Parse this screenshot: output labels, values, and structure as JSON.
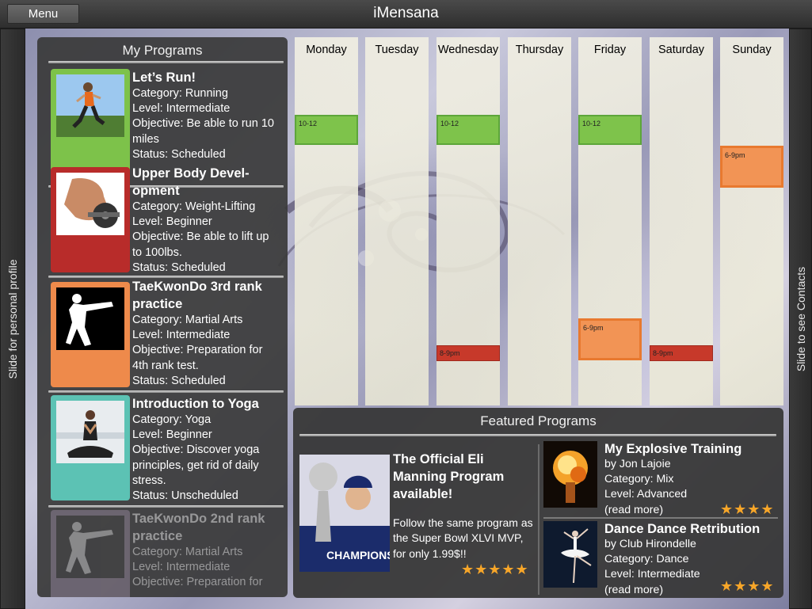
{
  "app": {
    "title": "iMensana",
    "menu_label": "Menu"
  },
  "side": {
    "left_label": "Slide for personal profile",
    "right_label": "Slide to see Contacts"
  },
  "programs": {
    "title": "My Programs",
    "items": [
      {
        "name": "Let’s Run!",
        "category": "Category: Running",
        "level": "Level: Intermediate",
        "objective": "Objective: Be able to run 10 miles",
        "status": "Status: Scheduled",
        "color": "#7dc24a"
      },
      {
        "name": "Upper Body Devel-opment",
        "category": "Category: Weight-Lifting",
        "level": "Level: Beginner",
        "objective": "Objective: Be able to lift up to 100lbs.",
        "status": "Status: Scheduled",
        "color": "#b82c2a"
      },
      {
        "name": "TaeKwonDo 3rd rank practice",
        "category": "Category: Martial Arts",
        "level": "Level: Intermediate",
        "objective": "Objective: Preparation for 4th rank test.",
        "status": "Status: Scheduled",
        "color": "#ee8a4b"
      },
      {
        "name": "Introduction to Yoga",
        "category": "Category: Yoga",
        "level": "Level: Beginner",
        "objective": "Objective: Discover yoga principles, get rid of daily stress.",
        "status": "Status: Unscheduled",
        "color": "#5cc2b4"
      },
      {
        "name": "TaeKwonDo 2nd rank practice",
        "category": "Category: Martial Arts",
        "level": "Level: Intermediate",
        "objective": "Objective: Preparation for",
        "status": "",
        "color": "#9e8fa6"
      }
    ]
  },
  "calendar": {
    "days": [
      "Monday",
      "Tuesday",
      "Wednesday",
      "Thursday",
      "Friday",
      "Saturday",
      "Sunday"
    ],
    "events": [
      {
        "day": "Monday",
        "time": "10-12",
        "color": "green"
      },
      {
        "day": "Wednesday",
        "time": "10-12",
        "color": "green"
      },
      {
        "day": "Friday",
        "time": "10-12",
        "color": "green"
      },
      {
        "day": "Sunday",
        "time": "6-9pm",
        "color": "orange"
      },
      {
        "day": "Friday",
        "time": "6-9pm",
        "color": "orange"
      },
      {
        "day": "Wednesday",
        "time": "8-9pm",
        "color": "red"
      },
      {
        "day": "Saturday",
        "time": "8-9pm",
        "color": "red"
      }
    ]
  },
  "featured": {
    "title": "Featured Programs",
    "main": {
      "title": "The Official Eli Manning Program available!",
      "description": "Follow the same program as the Super Bowl XLVI MVP, for only 1.99$!!",
      "stars": "★★★★★"
    },
    "items": [
      {
        "title": "My Explosive Training",
        "author": "by Jon Lajoie",
        "category": "Category: Mix",
        "level": "Level: Advanced",
        "more": "(read more)",
        "stars": "★★★★"
      },
      {
        "title": "Dance Dance Retribution",
        "author": "by Club Hirondelle",
        "category": "Category: Dance",
        "level": "Level: Intermediate",
        "more": "(read more)",
        "stars": "★★★★"
      }
    ]
  },
  "colors": {
    "green": "#7ec34b",
    "red": "#c7392a",
    "orange": "#f29455",
    "star": "#f7a629"
  }
}
